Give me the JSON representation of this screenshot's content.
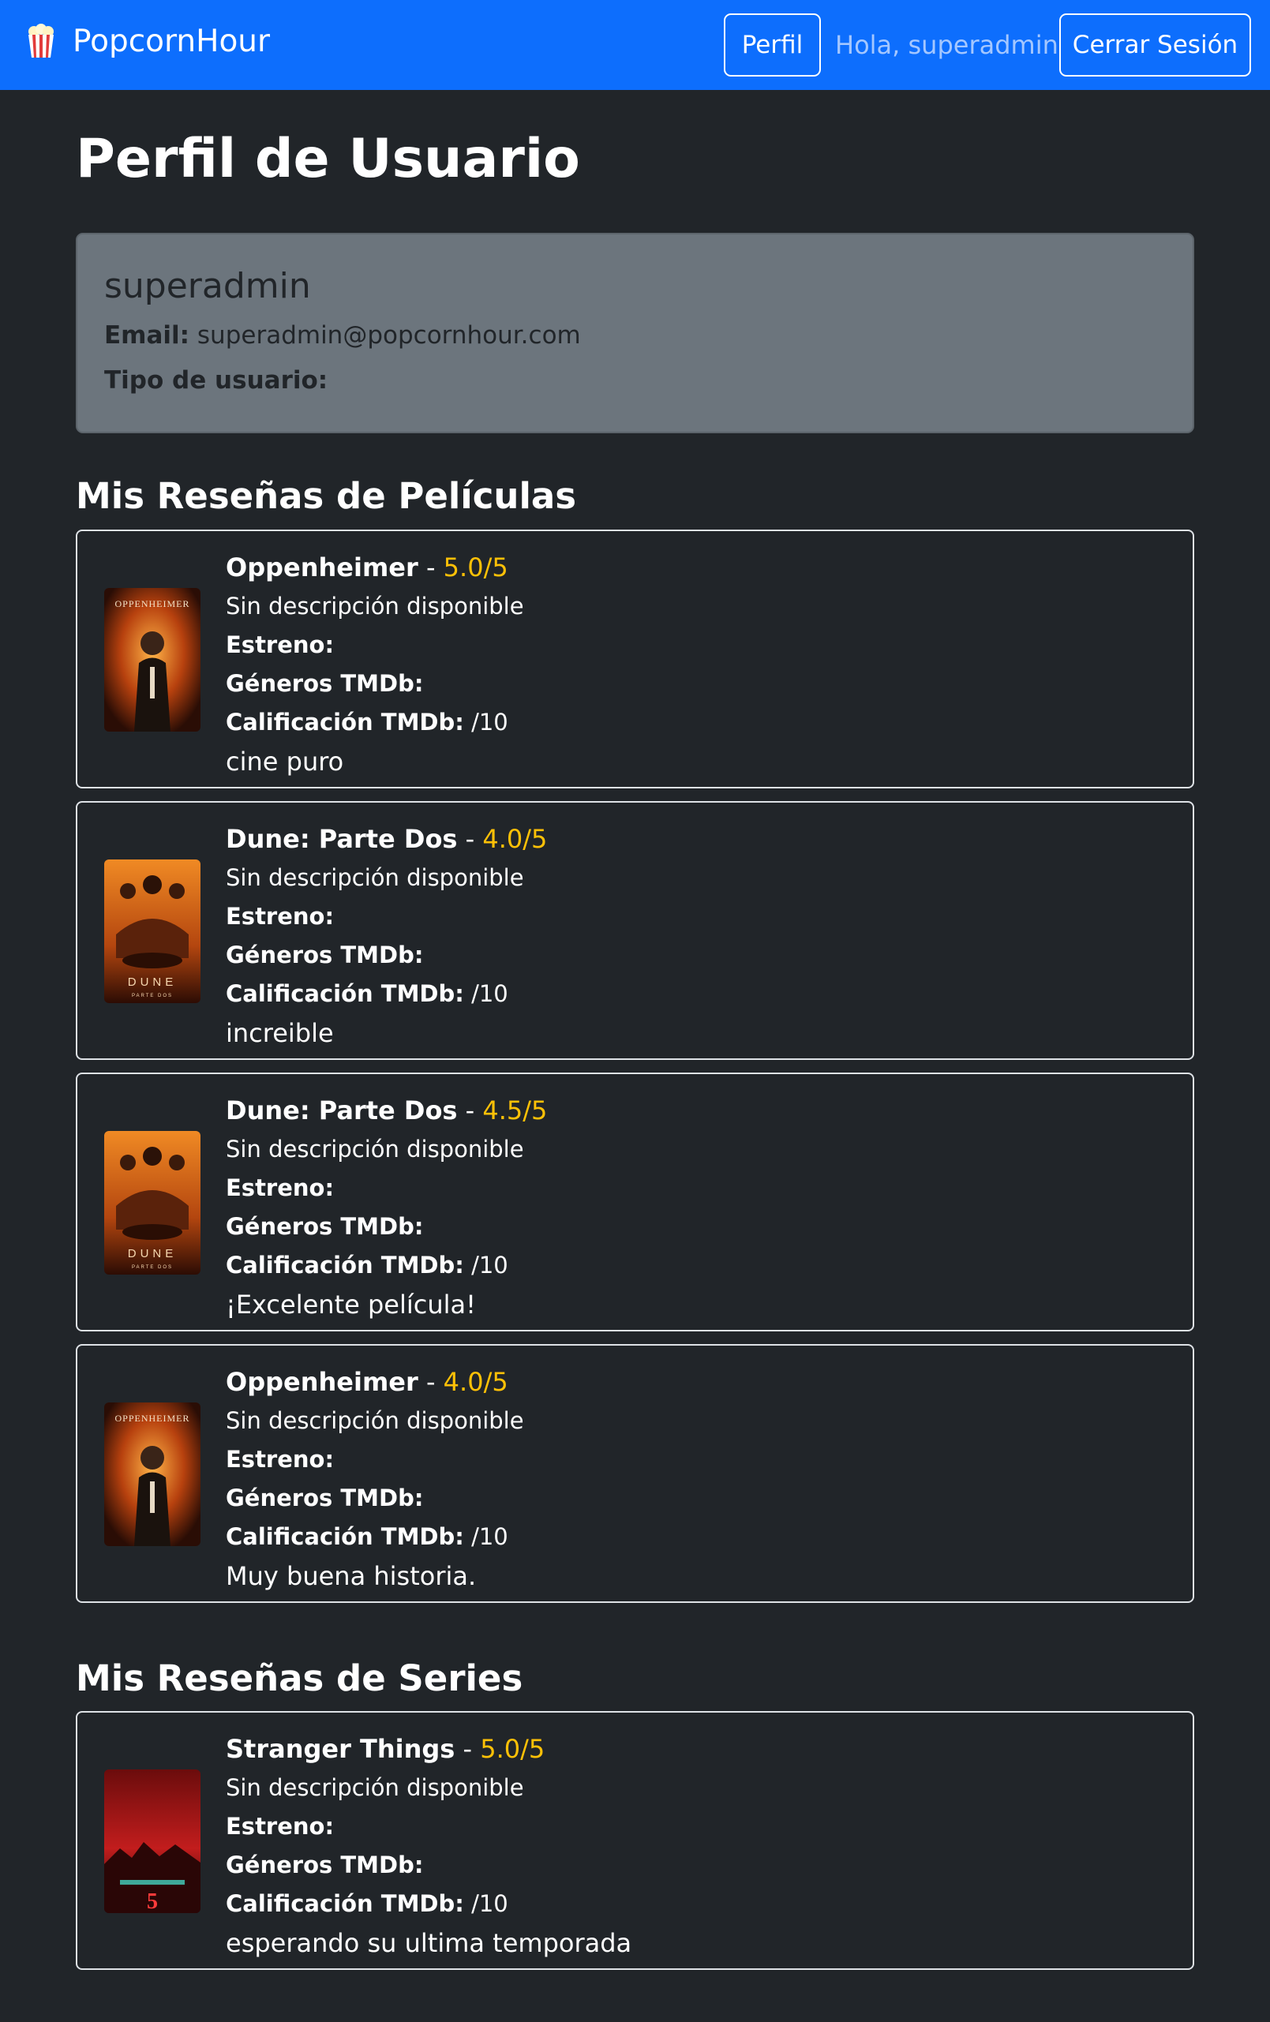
{
  "navbar": {
    "brand": "PopcornHour",
    "profile_button": "Perfil",
    "greeting": "Hola, superadmin",
    "logout_button": "Cerrar Sesión",
    "accent_color": "#0d6efd"
  },
  "page": {
    "title": "Perfil de Usuario"
  },
  "user": {
    "username": "superadmin",
    "email_label": "Email:",
    "email": "superadmin@popcornhour.com",
    "type_label": "Tipo de usuario:",
    "type_value": ""
  },
  "movies_section": {
    "title": "Mis Reseñas de Películas",
    "reviews": [
      {
        "title": "Oppenheimer",
        "rating": "5.0/5",
        "description": "Sin descripción disponible",
        "release_label": "Estreno:",
        "genres_label": "Géneros TMDb:",
        "tmdb_label": "Calificación TMDb:",
        "tmdb_value": "/10",
        "comment": "cine puro",
        "poster": "oppenheimer-poster"
      },
      {
        "title": "Dune: Parte Dos",
        "rating": "4.0/5",
        "description": "Sin descripción disponible",
        "release_label": "Estreno:",
        "genres_label": "Géneros TMDb:",
        "tmdb_label": "Calificación TMDb:",
        "tmdb_value": "/10",
        "comment": "increible",
        "poster": "dune-poster"
      },
      {
        "title": "Dune: Parte Dos",
        "rating": "4.5/5",
        "description": "Sin descripción disponible",
        "release_label": "Estreno:",
        "genres_label": "Géneros TMDb:",
        "tmdb_label": "Calificación TMDb:",
        "tmdb_value": "/10",
        "comment": "¡Excelente película!",
        "poster": "dune-poster"
      },
      {
        "title": "Oppenheimer",
        "rating": "4.0/5",
        "description": "Sin descripción disponible",
        "release_label": "Estreno:",
        "genres_label": "Géneros TMDb:",
        "tmdb_label": "Calificación TMDb:",
        "tmdb_value": "/10",
        "comment": "Muy buena historia.",
        "poster": "oppenheimer-poster"
      }
    ]
  },
  "series_section": {
    "title": "Mis Reseñas de Series",
    "reviews": [
      {
        "title": "Stranger Things",
        "rating": "5.0/5",
        "description": "Sin descripción disponible",
        "release_label": "Estreno:",
        "genres_label": "Géneros TMDb:",
        "tmdb_label": "Calificación TMDb:",
        "tmdb_value": "/10",
        "comment": "esperando su ultima temporada",
        "poster": "stranger-things-poster"
      }
    ]
  },
  "poster_text": {
    "oppenheimer": "OPPENHEIMER",
    "dune": "DUNE",
    "dune_sub": "PARTE DOS",
    "stranger_things": "5"
  },
  "colors": {
    "background": "#212529",
    "rating": "#ffc107",
    "card": "#6c757d"
  }
}
